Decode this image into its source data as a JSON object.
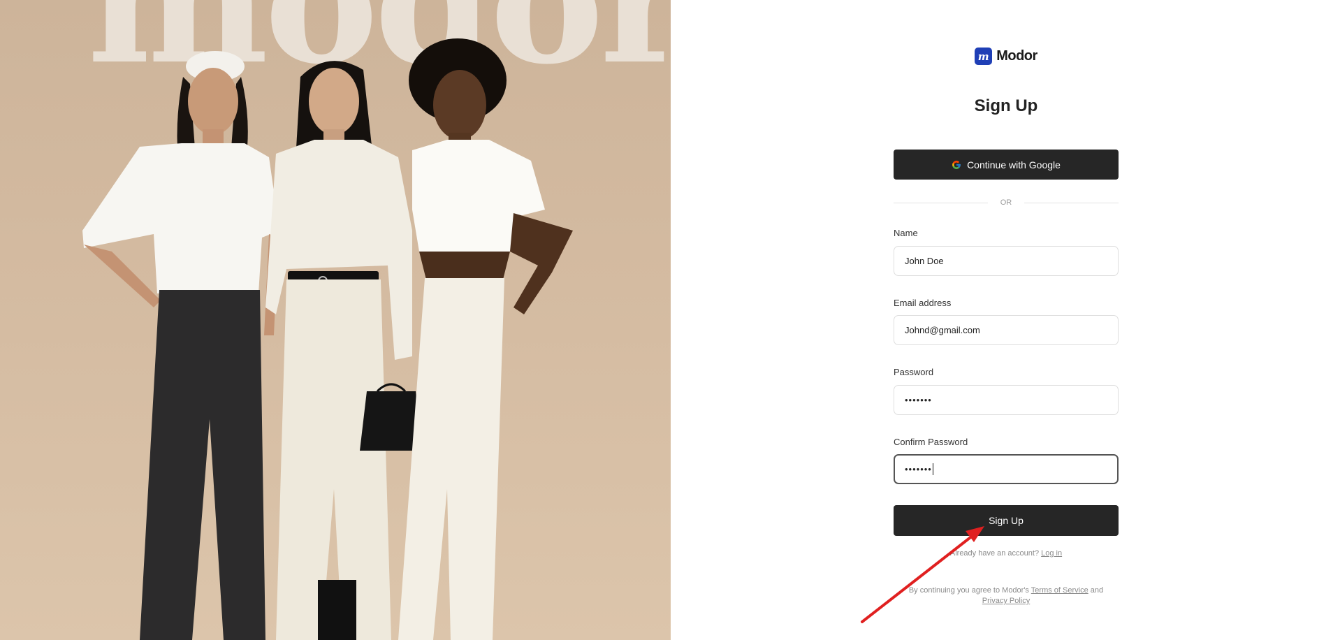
{
  "hero": {
    "watermark_text": "modor"
  },
  "brand": {
    "logo_letter": "m",
    "name": "Modor",
    "logo_color": "#1f3fb6"
  },
  "form": {
    "title": "Sign Up",
    "google_button_label": "Continue with Google",
    "divider_label": "OR",
    "fields": {
      "name": {
        "label": "Name",
        "value": "John Doe"
      },
      "email": {
        "label": "Email address",
        "value": "Johnd@gmail.com"
      },
      "password": {
        "label": "Password",
        "value": "•••••••"
      },
      "confirm_password": {
        "label": "Confirm Password",
        "value": "•••••••"
      }
    },
    "submit_label": "Sign Up",
    "login_prompt": "Already have an account?",
    "login_link": "Log in",
    "terms_prefix": "By continuing you agree to Modor's",
    "terms_link": "Terms of Service",
    "terms_and": "and",
    "privacy_link": "Privacy Policy"
  },
  "colors": {
    "button_bg": "#262626",
    "annotation_arrow": "#e02020",
    "hero_bg": "#d2b99f"
  }
}
